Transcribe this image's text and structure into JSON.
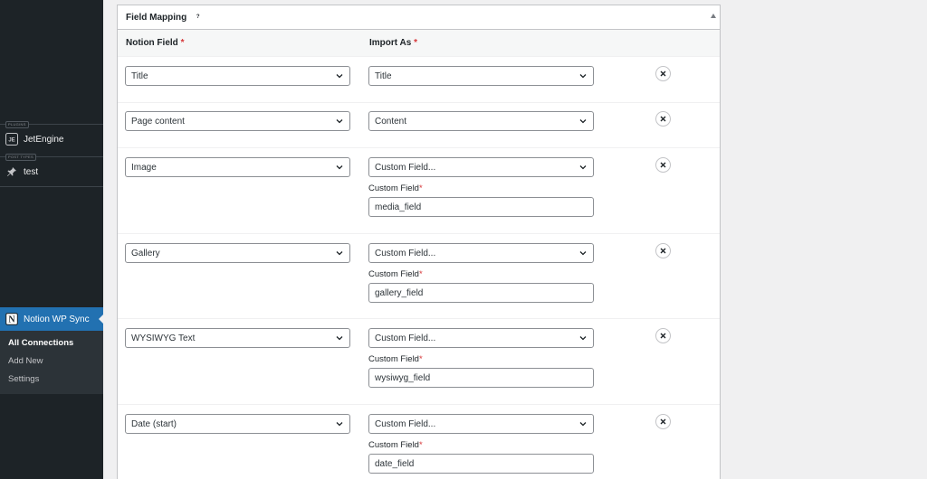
{
  "sidebar": {
    "sections": [
      {
        "separator": "PLUGINS",
        "label": "JetEngine",
        "icon": "jetengine-icon"
      },
      {
        "separator": "POST TYPES",
        "label": "test",
        "icon": "pin-icon"
      }
    ],
    "active": {
      "label": "Notion WP Sync",
      "icon": "notion-icon"
    },
    "submenu": [
      "All Connections",
      "Add New",
      "Settings"
    ],
    "current_submenu": "All Connections"
  },
  "panel": {
    "title": "Field Mapping",
    "help_symbol": "?",
    "columns": {
      "notion": "Notion Field",
      "import": "Import As",
      "required_mark": "*"
    },
    "custom_field_label": "Custom Field",
    "rows": [
      {
        "notion": "Title",
        "import": "Title"
      },
      {
        "notion": "Page content",
        "import": "Content"
      },
      {
        "notion": "Image",
        "import": "Custom Field...",
        "custom_field": "media_field"
      },
      {
        "notion": "Gallery",
        "import": "Custom Field...",
        "custom_field": "gallery_field"
      },
      {
        "notion": "WYSIWYG Text",
        "import": "Custom Field...",
        "custom_field": "wysiwyg_field"
      },
      {
        "notion": "Date (start)",
        "import": "Custom Field...",
        "custom_field": "date_field"
      }
    ]
  },
  "colors": {
    "sidebar_bg": "#1d2327",
    "active_bg": "#2271b1",
    "submenu_bg": "#2c3338",
    "required": "#d63638"
  }
}
